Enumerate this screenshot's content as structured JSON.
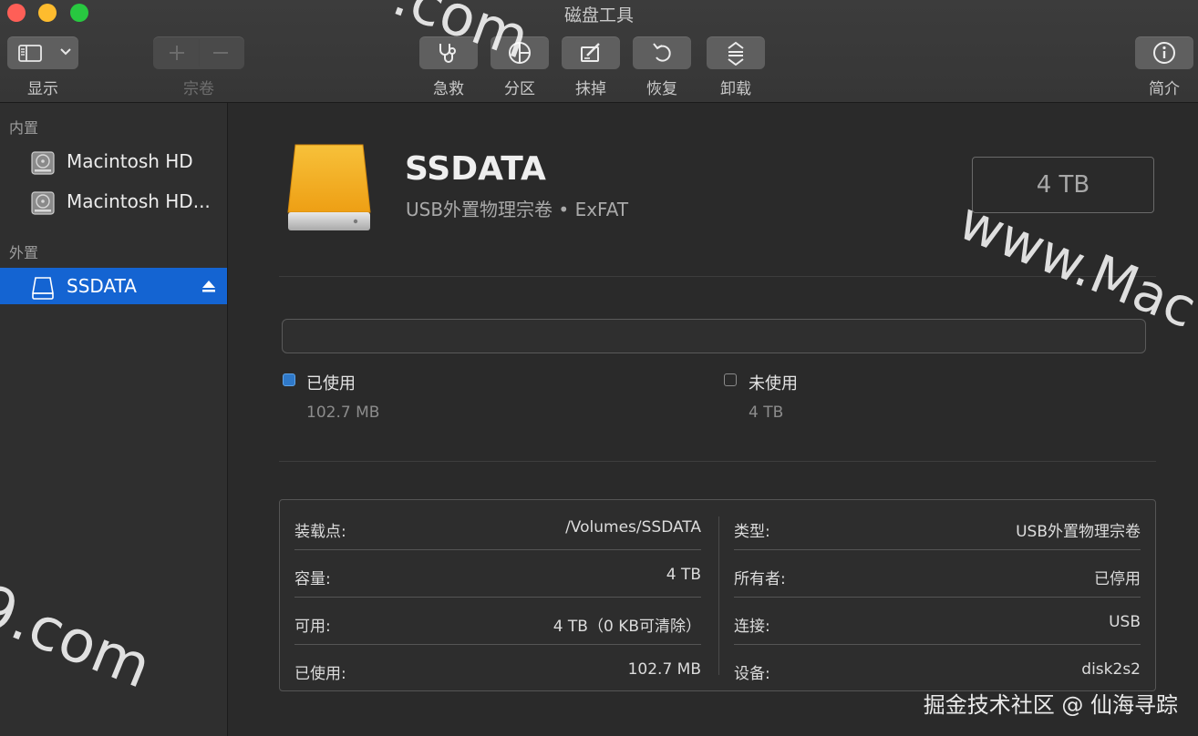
{
  "window": {
    "title": "磁盘工具"
  },
  "toolbar": {
    "view_label": "显示",
    "volume_label": "宗卷",
    "first_aid_label": "急救",
    "partition_label": "分区",
    "erase_label": "抹掉",
    "restore_label": "恢复",
    "unmount_label": "卸载",
    "info_label": "简介"
  },
  "sidebar": {
    "internal_header": "内置",
    "external_header": "外置",
    "internal_items": [
      {
        "label": "Macintosh HD"
      },
      {
        "label": "Macintosh HD..."
      }
    ],
    "external_items": [
      {
        "label": "SSDATA",
        "selected": true
      }
    ]
  },
  "volume": {
    "name": "SSDATA",
    "subtitle": "USB外置物理宗卷 • ExFAT",
    "capacity": "4 TB",
    "used_fraction": 0.0
  },
  "usage": {
    "used_label": "已使用",
    "used_value": "102.7 MB",
    "free_label": "未使用",
    "free_value": "4 TB"
  },
  "info": {
    "left": [
      {
        "key": "装载点:",
        "value": "/Volumes/SSDATA"
      },
      {
        "key": "容量:",
        "value": "4 TB"
      },
      {
        "key": "可用:",
        "value": "4 TB（0 KB可清除）"
      },
      {
        "key": "已使用:",
        "value": "102.7 MB"
      }
    ],
    "right": [
      {
        "key": "类型:",
        "value": "USB外置物理宗卷"
      },
      {
        "key": "所有者:",
        "value": "已停用"
      },
      {
        "key": "连接:",
        "value": "USB"
      },
      {
        "key": "设备:",
        "value": "disk2s2"
      }
    ]
  },
  "watermarks": {
    "top": ".com",
    "right": "www.Mac",
    "left": "9.com",
    "credit": "掘金技术社区 @ 仙海寻踪"
  },
  "colors": {
    "selection": "#1464d2",
    "used": "#2f79c9",
    "drive": "#f4b227"
  }
}
